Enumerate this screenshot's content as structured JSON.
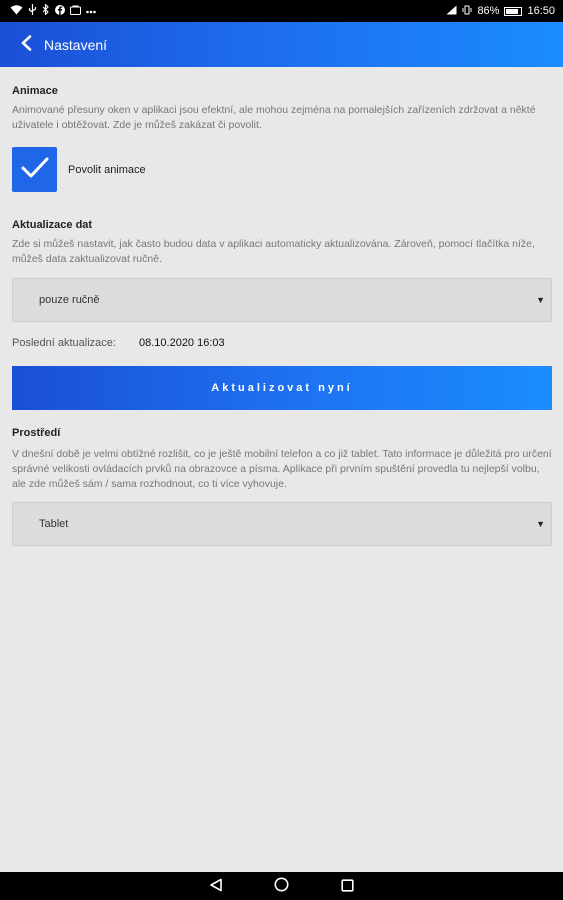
{
  "status_bar": {
    "battery": "86%",
    "time": "16:50",
    "icons": [
      "wifi-icon",
      "usb-icon",
      "bluetooth-icon",
      "facebook-icon",
      "notification-icon",
      "more-icon"
    ]
  },
  "header": {
    "title": "Nastavení",
    "back_icon": "chevron-left-icon"
  },
  "animations": {
    "title": "Animace",
    "description": "Animované přesuny oken v aplikaci jsou efektní, ale mohou zejména na pomalejších zařízeních zdržovat a někté uživatele i obtěžovat. Zde je můžeš zakázat či povolit.",
    "checkbox_label": "Povolit animace",
    "checked": true
  },
  "data_update": {
    "title": "Aktualizace dat",
    "description": "Zde si můžeš nastavit, jak často budou data v aplikaci automaticky aktualizována. Zároveň, pomocí tlačítka níže, můžeš data zaktualizovat ručně.",
    "select_value": "pouze ručně",
    "last_update_label": "Poslední aktualizace:",
    "last_update_value": "08.10.2020 16:03",
    "update_button": "Aktualizovat nyní"
  },
  "environment": {
    "title": "Prostředí",
    "description": "V dnešní době je velmi obtížné rozlišit, co je ještě mobilní telefon a co již tablet. Tato informace je důležitá pro určení správné velikosti ovládacích prvků na obrazovce a písma. Aplikace při prvním spuštění provedla tu nejlepší volbu, ale zde můžeš sám / sama rozhodnout, co ti více vyhovuje.",
    "select_value": "Tablet"
  },
  "nav_bar": {
    "icons": [
      "back-triangle-icon",
      "home-circle-icon",
      "recents-square-icon"
    ]
  },
  "colors": {
    "accent": "#1f66e8",
    "background": "#e8e8e8",
    "select_bg": "#dcdcdc"
  }
}
